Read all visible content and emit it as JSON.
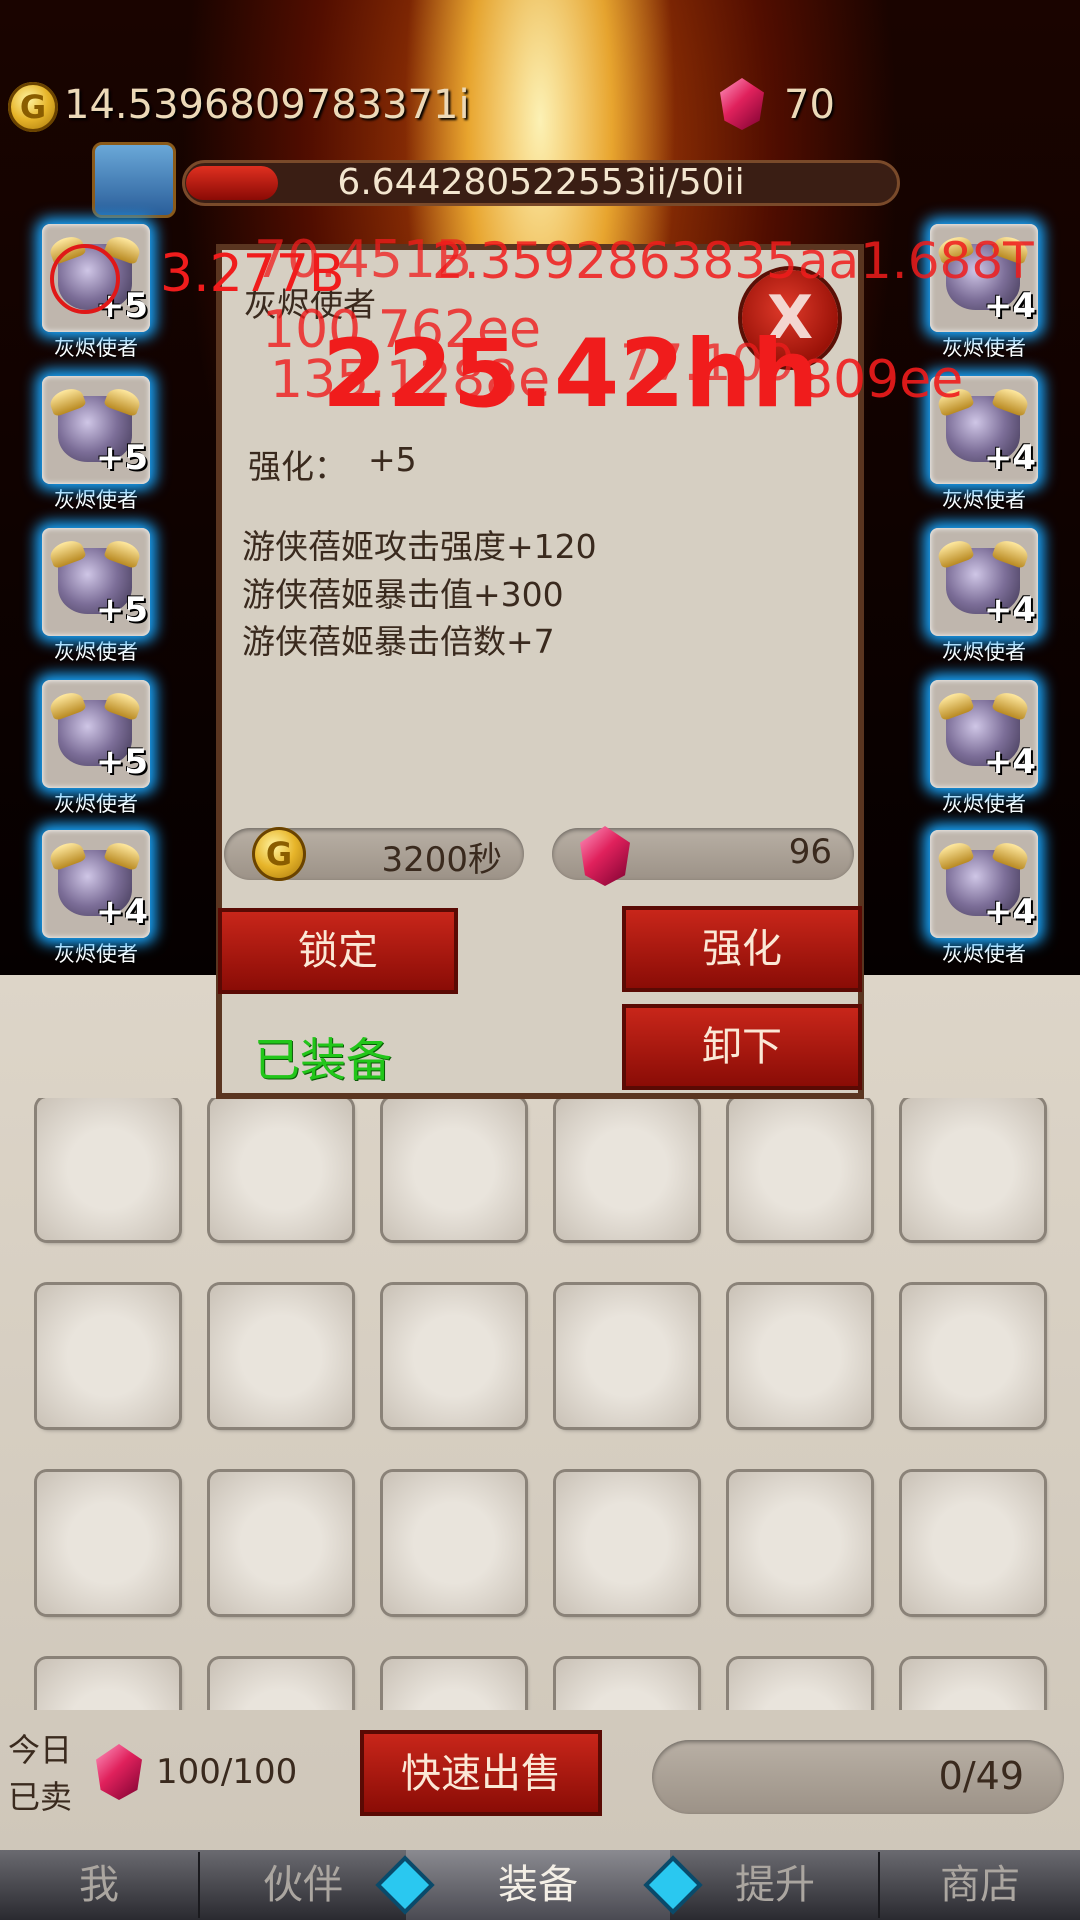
{
  "top": {
    "gold": "14.5396809783371i",
    "gems": "70"
  },
  "progress": {
    "text": "6.644280522553ii/50ii",
    "fraction": 0.13
  },
  "left_slots": [
    {
      "name": "灰烬使者",
      "plus": "+5"
    },
    {
      "name": "灰烬使者",
      "plus": "+5"
    },
    {
      "name": "灰烬使者",
      "plus": "+5"
    },
    {
      "name": "灰烬使者",
      "plus": "+5"
    },
    {
      "name": "灰烬使者",
      "plus": "+4"
    }
  ],
  "right_slots": [
    {
      "name": "灰烬使者",
      "plus": "+4"
    },
    {
      "name": "灰烬使者",
      "plus": "+4"
    },
    {
      "name": "灰烬使者",
      "plus": "+4"
    },
    {
      "name": "灰烬使者",
      "plus": "+4"
    },
    {
      "name": "灰烬使者",
      "plus": "+4"
    }
  ],
  "popup": {
    "item_name": "灰烬使者",
    "close_label": "X",
    "enhance_label": "强化：",
    "enhance_value": "+5",
    "stats": [
      "游侠蓓姬攻击强度+120",
      "游侠蓓姬暴击值+300",
      "游侠蓓姬暴击倍数+7"
    ],
    "gold_cost": "3200秒",
    "gem_cost": "96",
    "lock_label": "锁定",
    "upgrade_label": "强化",
    "unequip_label": "卸下",
    "equipped_label": "已装备"
  },
  "floating": {
    "f1": "3.277B",
    "f2": "70.451B",
    "f3": "2.3592863835aa",
    "f4": "1.688T",
    "f5": "100.762ee",
    "f6": "135.1288e",
    "f7": "225.42hh",
    "f8": "77.109",
    "f9": "809ee"
  },
  "bottom": {
    "sold_label_1": "今日",
    "sold_label_2": "已卖",
    "sold_count": "100/100",
    "quick_sell_label": "快速出售",
    "capacity": "0/49"
  },
  "tabs": [
    "我",
    "伙伴",
    "装备",
    "提升",
    "商店"
  ],
  "colors": {
    "accent_red": "#c8261a",
    "equipped_green": "#22c61a",
    "damage_red": "#f01c1c"
  }
}
